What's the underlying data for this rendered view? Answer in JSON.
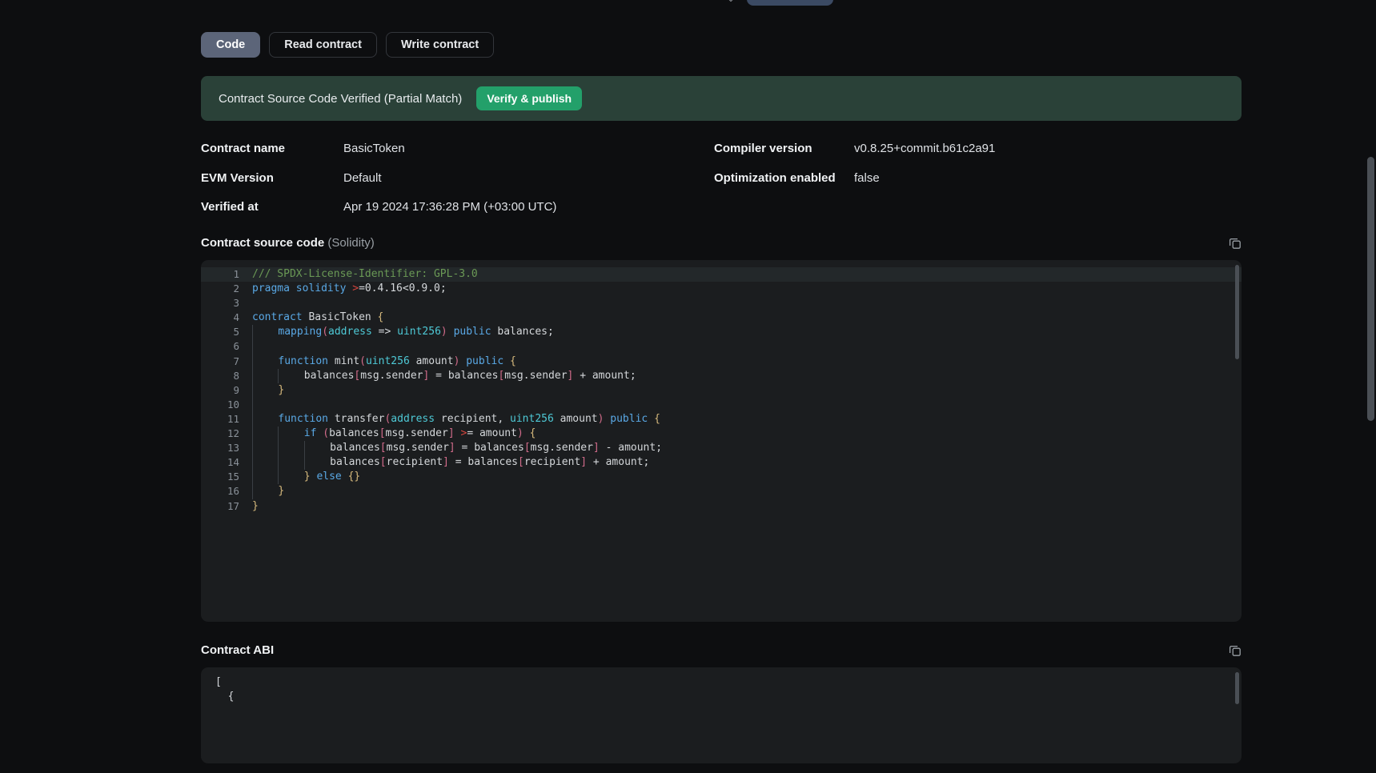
{
  "tabs": [
    {
      "label": "Code",
      "active": true
    },
    {
      "label": "Read contract",
      "active": false
    },
    {
      "label": "Write contract",
      "active": false
    }
  ],
  "banner": {
    "status_text": "Contract Source Code Verified (Partial Match)",
    "button_label": "Verify & publish",
    "background_color": "#2a4138",
    "button_color": "#23a06a"
  },
  "metadata": {
    "left": [
      {
        "label": "Contract name",
        "value": "BasicToken"
      },
      {
        "label": "EVM Version",
        "value": "Default"
      },
      {
        "label": "Verified at",
        "value": "Apr 19 2024 17:36:28 PM (+03:00 UTC)"
      }
    ],
    "right": [
      {
        "label": "Compiler version",
        "value": "v0.8.25+commit.b61c2a91"
      },
      {
        "label": "Optimization enabled",
        "value": "false"
      }
    ]
  },
  "source_section": {
    "title": "Contract source code",
    "language": "(Solidity)",
    "copy_icon": "copy-icon"
  },
  "source_code": {
    "language": "solidity",
    "lines": [
      {
        "n": 1,
        "highlight": true,
        "indent": 0,
        "tokens": [
          {
            "t": "/// SPDX-License-Identifier: GPL-3.0",
            "c": "cm"
          }
        ]
      },
      {
        "n": 2,
        "highlight": false,
        "indent": 0,
        "tokens": [
          {
            "t": "pragma",
            "c": "k"
          },
          {
            "t": " ",
            "c": "pln"
          },
          {
            "t": "solidity",
            "c": "k"
          },
          {
            "t": " ",
            "c": "pln"
          },
          {
            "t": ">",
            "c": "op"
          },
          {
            "t": "=0.4.16<0.9.0;",
            "c": "pln"
          }
        ]
      },
      {
        "n": 3,
        "highlight": false,
        "indent": 0,
        "tokens": []
      },
      {
        "n": 4,
        "highlight": false,
        "indent": 0,
        "tokens": [
          {
            "t": "contract",
            "c": "k"
          },
          {
            "t": " BasicToken ",
            "c": "pln"
          },
          {
            "t": "{",
            "c": "brc"
          }
        ]
      },
      {
        "n": 5,
        "highlight": false,
        "indent": 1,
        "tokens": [
          {
            "t": "mapping",
            "c": "k"
          },
          {
            "t": "(",
            "c": "br"
          },
          {
            "t": "address",
            "c": "typ"
          },
          {
            "t": " => ",
            "c": "pln"
          },
          {
            "t": "uint256",
            "c": "typ"
          },
          {
            "t": ")",
            "c": "br"
          },
          {
            "t": " ",
            "c": "pln"
          },
          {
            "t": "public",
            "c": "k"
          },
          {
            "t": " balances;",
            "c": "pln"
          }
        ]
      },
      {
        "n": 6,
        "highlight": false,
        "indent": 1,
        "tokens": []
      },
      {
        "n": 7,
        "highlight": false,
        "indent": 1,
        "tokens": [
          {
            "t": "function",
            "c": "k"
          },
          {
            "t": " mint",
            "c": "pln"
          },
          {
            "t": "(",
            "c": "br"
          },
          {
            "t": "uint256",
            "c": "typ"
          },
          {
            "t": " amount",
            "c": "pln"
          },
          {
            "t": ")",
            "c": "br"
          },
          {
            "t": " ",
            "c": "pln"
          },
          {
            "t": "public",
            "c": "k"
          },
          {
            "t": " ",
            "c": "pln"
          },
          {
            "t": "{",
            "c": "brc"
          }
        ]
      },
      {
        "n": 8,
        "highlight": false,
        "indent": 2,
        "tokens": [
          {
            "t": "balances",
            "c": "pln"
          },
          {
            "t": "[",
            "c": "br"
          },
          {
            "t": "msg.sender",
            "c": "pln"
          },
          {
            "t": "]",
            "c": "br"
          },
          {
            "t": " = balances",
            "c": "pln"
          },
          {
            "t": "[",
            "c": "br"
          },
          {
            "t": "msg.sender",
            "c": "pln"
          },
          {
            "t": "]",
            "c": "br"
          },
          {
            "t": " + amount;",
            "c": "pln"
          }
        ]
      },
      {
        "n": 9,
        "highlight": false,
        "indent": 1,
        "tokens": [
          {
            "t": "}",
            "c": "brc"
          }
        ]
      },
      {
        "n": 10,
        "highlight": false,
        "indent": 1,
        "tokens": []
      },
      {
        "n": 11,
        "highlight": false,
        "indent": 1,
        "tokens": [
          {
            "t": "function",
            "c": "k"
          },
          {
            "t": " transfer",
            "c": "pln"
          },
          {
            "t": "(",
            "c": "br"
          },
          {
            "t": "address",
            "c": "typ"
          },
          {
            "t": " recipient, ",
            "c": "pln"
          },
          {
            "t": "uint256",
            "c": "typ"
          },
          {
            "t": " amount",
            "c": "pln"
          },
          {
            "t": ")",
            "c": "br"
          },
          {
            "t": " ",
            "c": "pln"
          },
          {
            "t": "public",
            "c": "k"
          },
          {
            "t": " ",
            "c": "pln"
          },
          {
            "t": "{",
            "c": "brc"
          }
        ]
      },
      {
        "n": 12,
        "highlight": false,
        "indent": 2,
        "tokens": [
          {
            "t": "if",
            "c": "k"
          },
          {
            "t": " ",
            "c": "pln"
          },
          {
            "t": "(",
            "c": "br"
          },
          {
            "t": "balances",
            "c": "pln"
          },
          {
            "t": "[",
            "c": "br"
          },
          {
            "t": "msg.sender",
            "c": "pln"
          },
          {
            "t": "]",
            "c": "br"
          },
          {
            "t": " ",
            "c": "pln"
          },
          {
            "t": ">",
            "c": "op"
          },
          {
            "t": "= amount",
            "c": "pln"
          },
          {
            "t": ")",
            "c": "br"
          },
          {
            "t": " ",
            "c": "pln"
          },
          {
            "t": "{",
            "c": "brc"
          }
        ]
      },
      {
        "n": 13,
        "highlight": false,
        "indent": 3,
        "tokens": [
          {
            "t": "balances",
            "c": "pln"
          },
          {
            "t": "[",
            "c": "br"
          },
          {
            "t": "msg.sender",
            "c": "pln"
          },
          {
            "t": "]",
            "c": "br"
          },
          {
            "t": " = balances",
            "c": "pln"
          },
          {
            "t": "[",
            "c": "br"
          },
          {
            "t": "msg.sender",
            "c": "pln"
          },
          {
            "t": "]",
            "c": "br"
          },
          {
            "t": " - amount;",
            "c": "pln"
          }
        ]
      },
      {
        "n": 14,
        "highlight": false,
        "indent": 3,
        "tokens": [
          {
            "t": "balances",
            "c": "pln"
          },
          {
            "t": "[",
            "c": "br"
          },
          {
            "t": "recipient",
            "c": "pln"
          },
          {
            "t": "]",
            "c": "br"
          },
          {
            "t": " = balances",
            "c": "pln"
          },
          {
            "t": "[",
            "c": "br"
          },
          {
            "t": "recipient",
            "c": "pln"
          },
          {
            "t": "]",
            "c": "br"
          },
          {
            "t": " + amount;",
            "c": "pln"
          }
        ]
      },
      {
        "n": 15,
        "highlight": false,
        "indent": 2,
        "tokens": [
          {
            "t": "}",
            "c": "brc"
          },
          {
            "t": " ",
            "c": "pln"
          },
          {
            "t": "else",
            "c": "k"
          },
          {
            "t": " ",
            "c": "pln"
          },
          {
            "t": "{}",
            "c": "brc"
          }
        ]
      },
      {
        "n": 16,
        "highlight": false,
        "indent": 1,
        "tokens": [
          {
            "t": "}",
            "c": "brc"
          }
        ]
      },
      {
        "n": 17,
        "highlight": false,
        "indent": 0,
        "tokens": [
          {
            "t": "}",
            "c": "brc"
          }
        ]
      }
    ]
  },
  "abi_section": {
    "title": "Contract ABI",
    "copy_icon": "copy-icon",
    "content": "[\n  {"
  }
}
